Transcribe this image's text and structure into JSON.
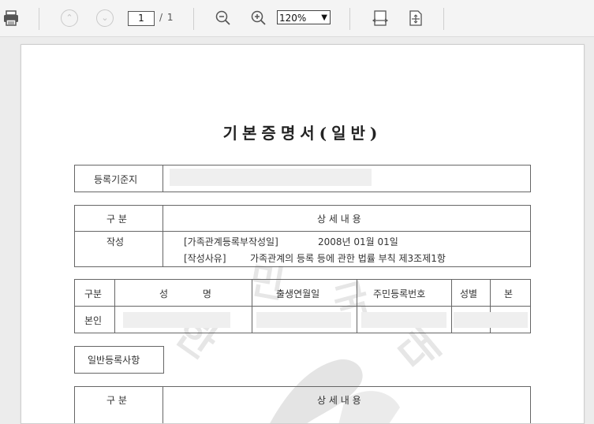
{
  "toolbar": {
    "page_current": "1",
    "page_total": "/ 1",
    "zoom": "120%"
  },
  "document": {
    "title": "기본증명서(일반)",
    "registry_label": "등록기준지",
    "section1": {
      "col_category": "구 분",
      "col_details": "상 세 내 용",
      "row_label": "작성",
      "line1_key": "[가족관계등록부작성일]",
      "line1_value": "2008년 01월 01일",
      "line2_key": "[작성사유]",
      "line2_value": "가족관계의 등록 등에 관한 법률 부칙 제3조제1항"
    },
    "person_table": {
      "headers": [
        "구분",
        "성 명",
        "출생연월일",
        "주민등록번호",
        "성별",
        "본"
      ],
      "row_label": "본인"
    },
    "general_section_label": "일반등록사항",
    "section2": {
      "col_category": "구 분",
      "col_details": "상 세 내 용"
    }
  },
  "icons": [
    "print-icon",
    "prev-page-icon",
    "next-page-icon",
    "zoom-out-icon",
    "zoom-in-icon",
    "fit-width-icon",
    "fit-page-icon"
  ]
}
